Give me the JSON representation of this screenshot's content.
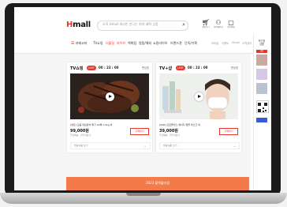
{
  "colors": {
    "brand": "#e8352b",
    "banner": "#f47a4a"
  },
  "header": {
    "logo_h": "H",
    "logo_rest": "mall",
    "search_placeholder": "오직 Hmall 에서만 만나는 최대 혜택 상품",
    "search_icon": "search-icon",
    "utilities": [
      {
        "icon": "cart-icon",
        "label": "장바구니"
      },
      {
        "icon": "user-icon",
        "label": "마이페이지"
      },
      {
        "icon": "order-icon",
        "label": "주문/배송"
      }
    ]
  },
  "categories": {
    "all_label": "카테고리",
    "items": [
      "TV쇼핑",
      "더블딜",
      "라이브",
      "백화점",
      "명품/해외",
      "쇼핑라이브",
      "브랜드관",
      "단독/기획"
    ],
    "right_items": [
      "모바일",
      "이벤트",
      "Hmall",
      "고객센터"
    ]
  },
  "cards": [
    {
      "title": "TV쇼핑",
      "live": "LIVE",
      "timer": "00 : 23 : 00",
      "table": "편성표",
      "desc": "[세트] 모둠 양념갈비 특가 20팩 1.5kg 외",
      "price": "99,000원",
      "sub": "무료배송 · 할인적용가",
      "buy": "구매하기",
      "foot": "방송상품 보기"
    },
    {
      "title": "TV+샵",
      "live": "LIVE",
      "timer": "00 : 23 : 00",
      "table": "편성표",
      "desc": "[CNP] 프로폴리스 에너지 앰플 마스크 외",
      "price": "39,000원",
      "sub": "무료배송 · 할인적용가",
      "buy": "구매하기",
      "foot": "방송상품 보기"
    }
  ],
  "banner": {
    "text": "2023 블랙블라썸"
  },
  "rightbar": {
    "title_line1": "최근본",
    "title_line2": "상품",
    "badge": "세일"
  }
}
